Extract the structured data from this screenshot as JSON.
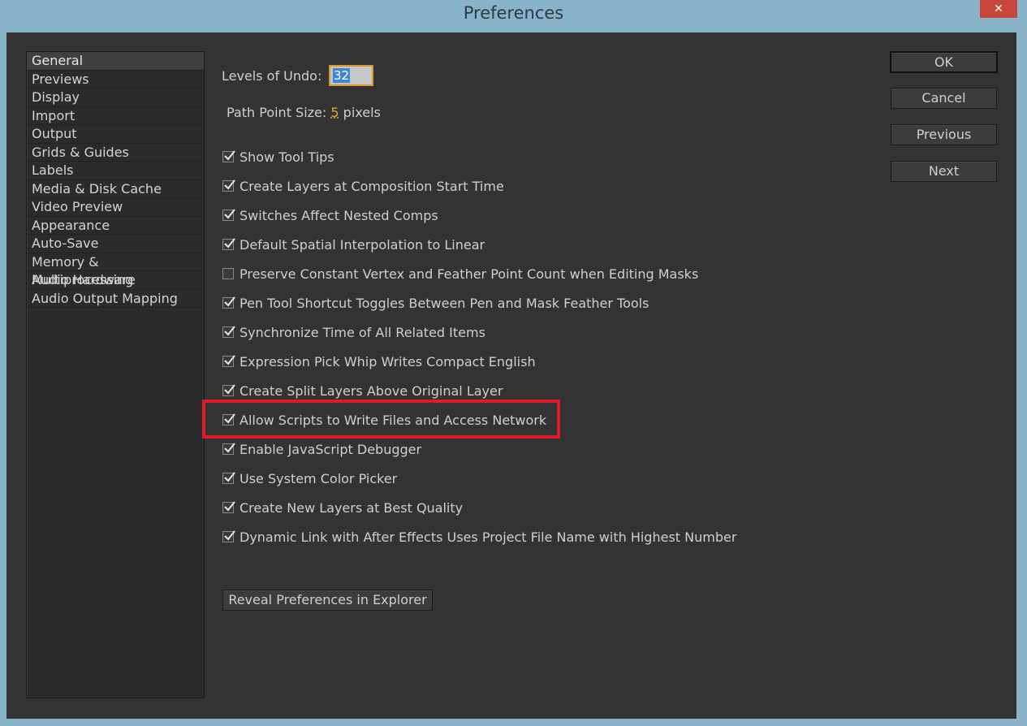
{
  "window": {
    "title": "Preferences",
    "close_glyph": "✕"
  },
  "sidebar": {
    "items": [
      {
        "label": "General",
        "selected": true
      },
      {
        "label": "Previews"
      },
      {
        "label": "Display"
      },
      {
        "label": "Import"
      },
      {
        "label": "Output"
      },
      {
        "label": "Grids & Guides"
      },
      {
        "label": "Labels"
      },
      {
        "label": "Media & Disk Cache"
      },
      {
        "label": "Video Preview"
      },
      {
        "label": "Appearance"
      },
      {
        "label": "Auto-Save"
      },
      {
        "label": "Memory & Multiprocessing"
      },
      {
        "label": "Audio Hardware"
      },
      {
        "label": "Audio Output Mapping"
      }
    ]
  },
  "general": {
    "undo_label": "Levels of Undo:",
    "undo_value": "32",
    "path_label": "Path Point Size:",
    "path_value": "5",
    "path_unit": "pixels",
    "options": [
      {
        "label": "Show Tool Tips",
        "checked": true
      },
      {
        "label": "Create Layers at Composition Start Time",
        "checked": true
      },
      {
        "label": "Switches Affect Nested Comps",
        "checked": true
      },
      {
        "label": "Default Spatial Interpolation to Linear",
        "checked": true
      },
      {
        "label": "Preserve Constant Vertex and Feather Point Count when Editing Masks",
        "checked": false
      },
      {
        "label": "Pen Tool Shortcut Toggles Between Pen and Mask Feather Tools",
        "checked": true
      },
      {
        "label": "Synchronize Time of All Related Items",
        "checked": true
      },
      {
        "label": "Expression Pick Whip Writes Compact English",
        "checked": true
      },
      {
        "label": "Create Split Layers Above Original Layer",
        "checked": true
      },
      {
        "label": "Allow Scripts to Write Files and Access Network",
        "checked": true
      },
      {
        "label": "Enable JavaScript Debugger",
        "checked": true
      },
      {
        "label": "Use System Color Picker",
        "checked": true
      },
      {
        "label": "Create New Layers at Best Quality",
        "checked": true
      },
      {
        "label": "Dynamic Link with After Effects Uses Project File Name with Highest Number",
        "checked": true
      }
    ],
    "reveal_label": "Reveal Preferences in Explorer"
  },
  "buttons": {
    "ok": "OK",
    "cancel": "Cancel",
    "previous": "Previous",
    "next": "Next"
  },
  "colors": {
    "highlight": "#e01a28",
    "accent": "#e4a629"
  }
}
